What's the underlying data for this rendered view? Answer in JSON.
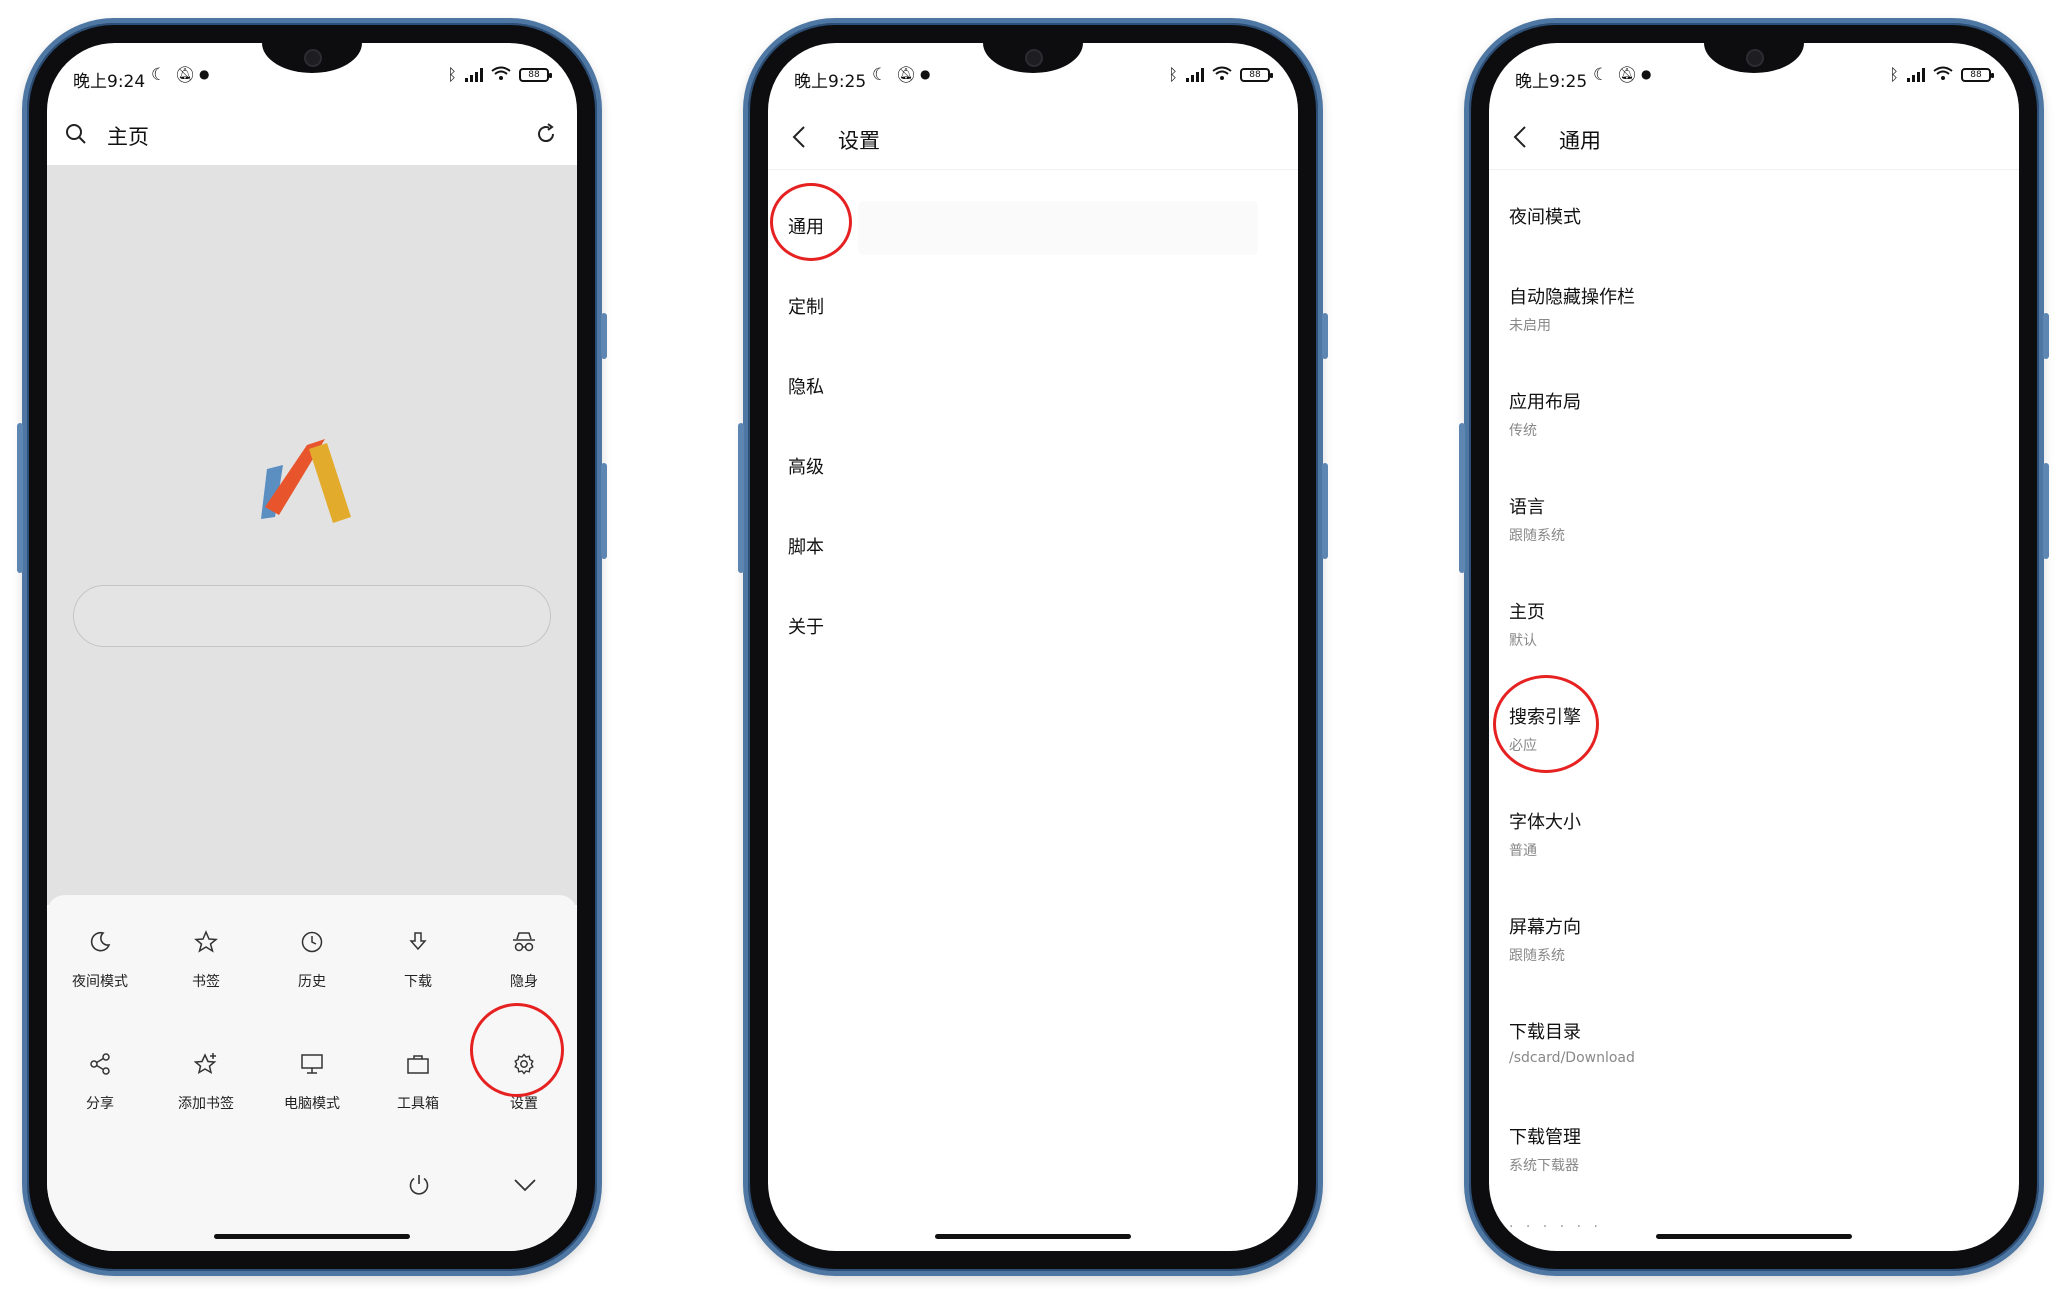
{
  "colors": {
    "frame": "#4e77a3",
    "highlight_circle": "#e52121",
    "home_bg": "#e2e2e2",
    "menu_bg": "#f7f7f7",
    "logo_blue": "#5b8fc2",
    "logo_red": "#e8552d",
    "logo_yellow": "#e3ab2c"
  },
  "phone1": {
    "status": {
      "time": "晚上9:24",
      "battery": "88"
    },
    "header": {
      "title": "主页"
    },
    "menu": {
      "row1": [
        "夜间模式",
        "书签",
        "历史",
        "下载",
        "隐身"
      ],
      "row2": [
        "分享",
        "添加书签",
        "电脑模式",
        "工具箱",
        "设置"
      ]
    },
    "icons": [
      "search-icon",
      "refresh-icon",
      "moon-icon",
      "star-icon",
      "clock-icon",
      "download-icon",
      "incognito-icon",
      "share-icon",
      "add-bookmark-icon",
      "monitor-icon",
      "toolbox-icon",
      "gear-icon",
      "power-icon",
      "chevron-down-icon"
    ]
  },
  "phone2": {
    "status": {
      "time": "晚上9:25",
      "battery": "88"
    },
    "header": {
      "title": "设置"
    },
    "items": [
      "通用",
      "定制",
      "隐私",
      "高级",
      "脚本",
      "关于"
    ]
  },
  "phone3": {
    "status": {
      "time": "晚上9:25",
      "battery": "88"
    },
    "header": {
      "title": "通用"
    },
    "items": [
      {
        "title": "夜间模式",
        "sub": ""
      },
      {
        "title": "自动隐藏操作栏",
        "sub": "未启用"
      },
      {
        "title": "应用布局",
        "sub": "传统"
      },
      {
        "title": "语言",
        "sub": "跟随系统"
      },
      {
        "title": "主页",
        "sub": "默认"
      },
      {
        "title": "搜索引擎",
        "sub": "必应"
      },
      {
        "title": "字体大小",
        "sub": "普通"
      },
      {
        "title": "屏幕方向",
        "sub": "跟随系统"
      },
      {
        "title": "下载目录",
        "sub": "/sdcard/Download"
      },
      {
        "title": "下载管理",
        "sub": "系统下载器"
      }
    ]
  }
}
